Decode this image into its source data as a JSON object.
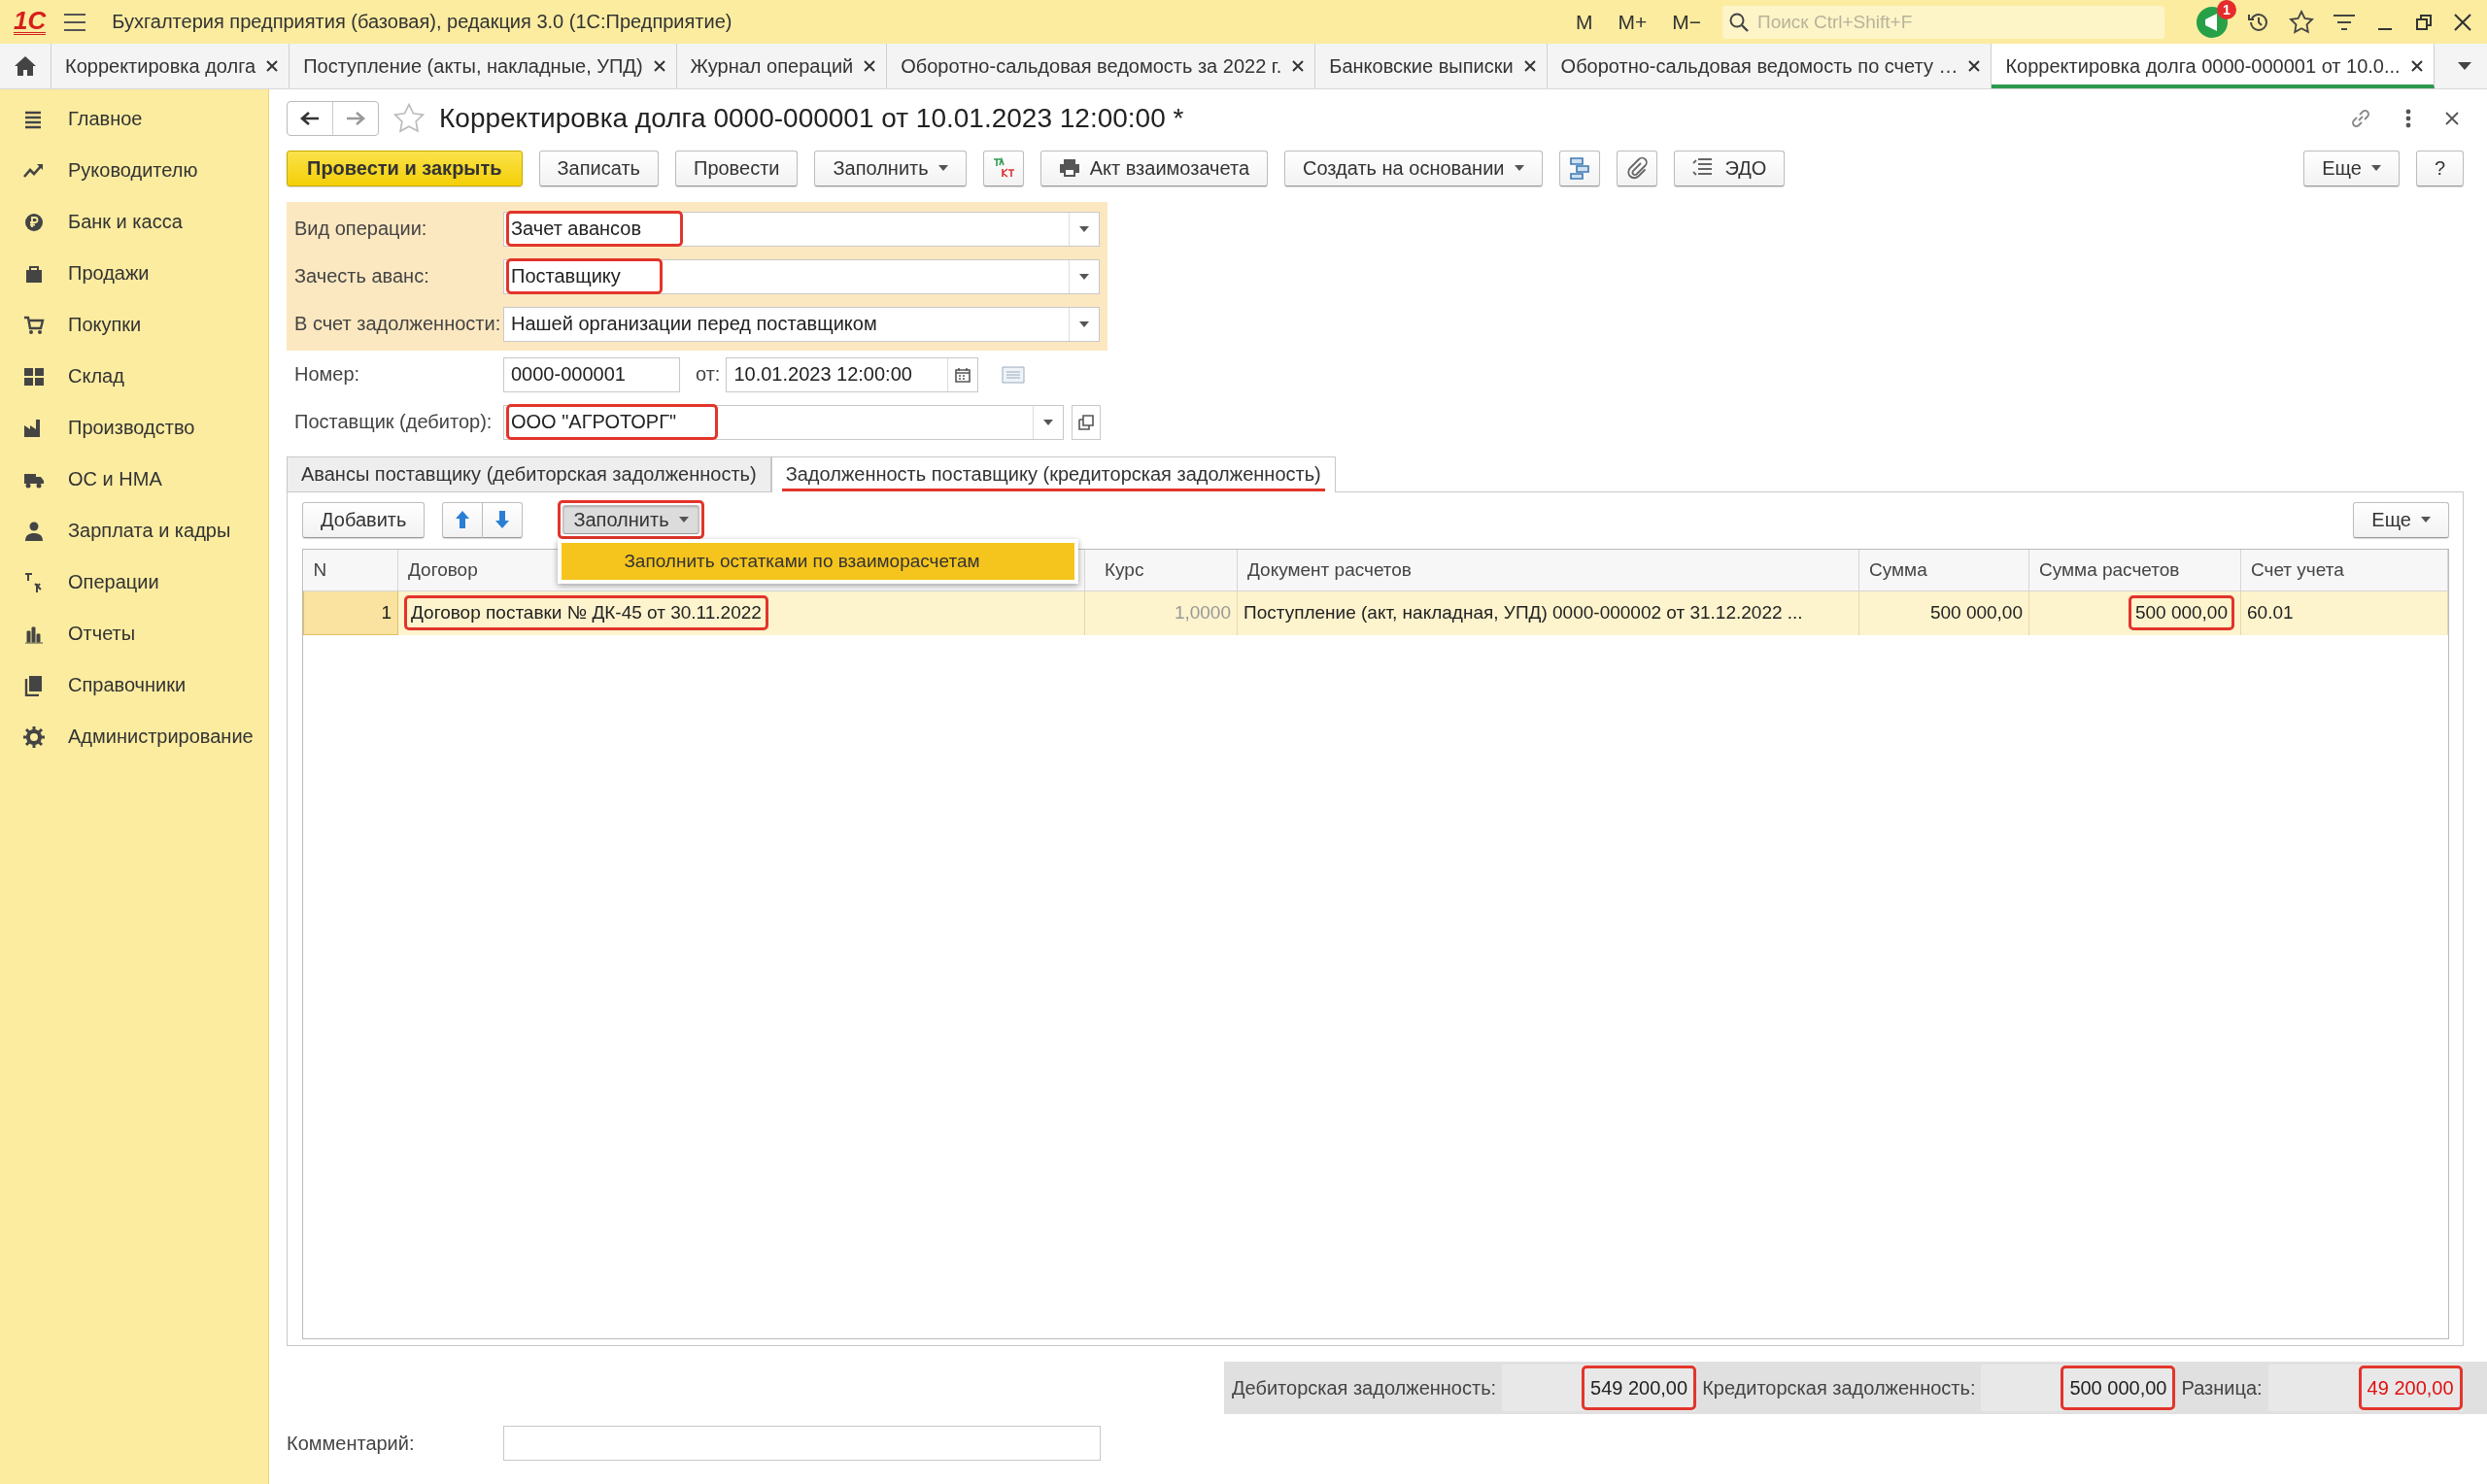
{
  "app_bar": {
    "logo": "1С",
    "title": "Бухгалтерия предприятия (базовая), редакция 3.0  (1С:Предприятие)",
    "memory_buttons": [
      "M",
      "M+",
      "M−"
    ],
    "search": {
      "placeholder": "Поиск Ctrl+Shift+F"
    },
    "notification_count": "1"
  },
  "open_tabs": [
    {
      "label": "Корректировка долга",
      "selected": false
    },
    {
      "label": "Поступление (акты, накладные, УПД)",
      "selected": false
    },
    {
      "label": "Журнал операций",
      "selected": false
    },
    {
      "label": "Оборотно-сальдовая ведомость за 2022 г.",
      "selected": false
    },
    {
      "label": "Банковские выписки",
      "selected": false
    },
    {
      "label": "Оборотно-сальдовая ведомость по счету …",
      "selected": false
    },
    {
      "label": "Корректировка долга 0000-000001 от 10.0...",
      "selected": true
    }
  ],
  "sidebar": {
    "items": [
      {
        "label": "Главное",
        "kind": "list"
      },
      {
        "label": "Руководителю",
        "kind": "trend"
      },
      {
        "label": "Банк и касса",
        "kind": "coin"
      },
      {
        "label": "Продажи",
        "kind": "bag"
      },
      {
        "label": "Покупки",
        "kind": "cart"
      },
      {
        "label": "Склад",
        "kind": "grid"
      },
      {
        "label": "Производство",
        "kind": "factory"
      },
      {
        "label": "ОС и НМА",
        "kind": "truck"
      },
      {
        "label": "Зарплата и кадры",
        "kind": "person"
      },
      {
        "label": "Операции",
        "kind": "dtkt"
      },
      {
        "label": "Отчеты",
        "kind": "bars"
      },
      {
        "label": "Справочники",
        "kind": "books"
      },
      {
        "label": "Администрирование",
        "kind": "gear"
      }
    ]
  },
  "document": {
    "title": "Корректировка долга 0000-000001 от 10.01.2023 12:00:00 *",
    "favorite": false,
    "toolbar": [
      {
        "kind": "primary",
        "label": "Провести и закрыть"
      },
      {
        "kind": "button",
        "label": "Записать"
      },
      {
        "kind": "button",
        "label": "Провести"
      },
      {
        "kind": "menu",
        "label": "Заполнить"
      },
      {
        "kind": "dtkt"
      },
      {
        "kind": "print",
        "label": "Акт взаимозачета"
      },
      {
        "kind": "menu",
        "label": "Создать на основании"
      },
      {
        "kind": "structure"
      },
      {
        "kind": "clip"
      },
      {
        "kind": "edo",
        "label": "ЭДО"
      }
    ],
    "toolbar_right": [
      {
        "kind": "menu",
        "label": "Еще"
      },
      {
        "kind": "button",
        "label": "?"
      }
    ],
    "operation_fields": [
      {
        "label": "Вид операции:",
        "value": "Зачет авансов",
        "highlighted": true
      },
      {
        "label": "Зачесть аванс:",
        "value": "Поставщику",
        "highlighted": true
      },
      {
        "label": "В счет задолженности:",
        "value": "Нашей организации перед поставщиком",
        "highlighted": false
      }
    ],
    "number": {
      "label": "Номер:",
      "value": "0000-000001"
    },
    "date": {
      "label": "от:",
      "value": "10.01.2023 12:00:00"
    },
    "supplier": {
      "label": "Поставщик (дебитор):",
      "value": "ООО \"АГРОТОРГ\"",
      "highlighted": true
    },
    "tabs": [
      {
        "label": "Авансы поставщику (дебиторская задолженность)",
        "selected": false,
        "highlighted": false
      },
      {
        "label": "Задолженность поставщику (кредиторская задолженность)",
        "selected": true,
        "highlighted": true
      }
    ],
    "table_toolbar": {
      "add": "Добавить",
      "fill": {
        "label": "Заполнить",
        "highlighted": true,
        "expanded": true
      },
      "more": "Еще"
    },
    "fill_menu": [
      "Заполнить остатками по взаиморасчетам"
    ],
    "table": {
      "columns": [
        {
          "title": "N",
          "kind": "number"
        },
        {
          "title": "Договор",
          "kind": "text"
        },
        {
          "title": "Курс",
          "kind": "number"
        },
        {
          "title": "Документ расчетов",
          "kind": "text"
        },
        {
          "title": "Сумма",
          "kind": "number"
        },
        {
          "title": "Сумма расчетов",
          "kind": "number"
        },
        {
          "title": "Счет учета",
          "kind": "text"
        }
      ],
      "rows": [
        {
          "selected": true,
          "cells": [
            {
              "text": "1",
              "highlighted": false,
              "disabled": false
            },
            {
              "text": "Договор поставки № ДК-45 от 30.11.2022",
              "highlighted": true,
              "disabled": false
            },
            {
              "text": "1,0000",
              "highlighted": false,
              "disabled": true
            },
            {
              "text": "Поступление (акт, накладная, УПД) 0000-000002 от 31.12.2022 ...",
              "highlighted": false,
              "disabled": false
            },
            {
              "text": "500 000,00",
              "highlighted": false,
              "disabled": false
            },
            {
              "text": "500 000,00",
              "highlighted": true,
              "disabled": false
            },
            {
              "text": "60.01",
              "highlighted": false,
              "disabled": false
            }
          ]
        }
      ]
    },
    "totals": [
      {
        "label": "Дебиторская задолженность:",
        "value": "549 200,00",
        "highlighted": true,
        "alert": false
      },
      {
        "label": "Кредиторская задолженность:",
        "value": "500 000,00",
        "highlighted": true,
        "alert": false
      },
      {
        "label": "Разница:",
        "value": "49 200,00",
        "highlighted": true,
        "alert": true
      }
    ],
    "comment": {
      "label": "Комментарий:"
    }
  }
}
